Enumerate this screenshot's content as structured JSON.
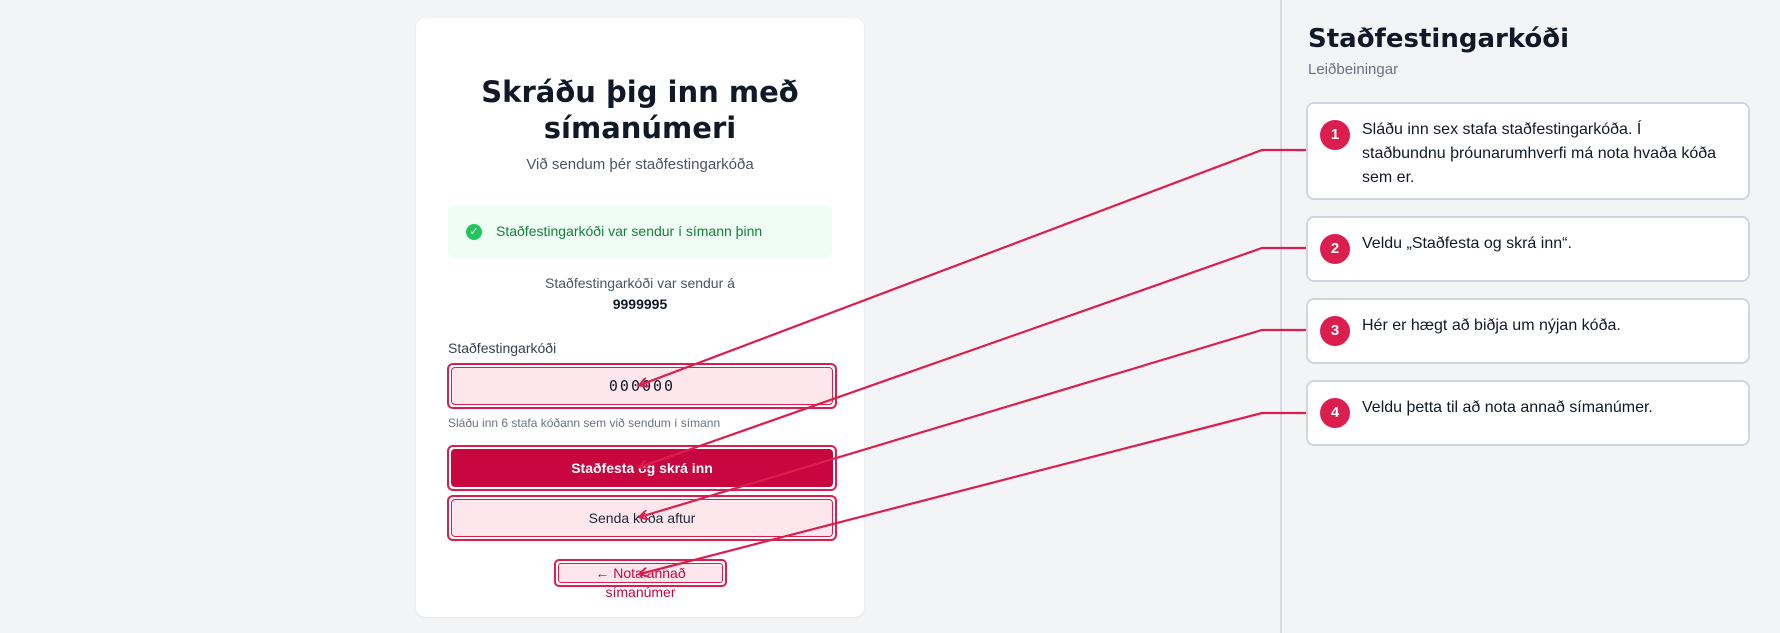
{
  "login": {
    "title": "Skráðu þig inn með símanúmeri",
    "subtitle": "Við sendum þér staðfestingarkóða",
    "alert": {
      "icon": "check-circle-icon",
      "text": "Staðfestingarkóði var sendur í símann þinn"
    },
    "sent_to_label": "Staðfestingarkóði var sendur á",
    "sent_to_phone": "9999995",
    "code_field": {
      "label": "Staðfestingarkóði",
      "value": "000000",
      "hint": "Sláðu inn 6 stafa kóðann sem við sendum í símann"
    },
    "confirm_button": "Staðfesta og skrá inn",
    "resend_button": "Senda kóða aftur",
    "change_phone_link": "← Nota annað símanúmer"
  },
  "panel": {
    "title": "Staðfestingarkóði",
    "subtitle": "Leiðbeiningar",
    "steps": [
      {
        "number": "1",
        "text": "Sláðu inn sex stafa staðfestingarkóða. Í staðbundnu þróunarumhverfi má nota hvaða kóða sem er."
      },
      {
        "number": "2",
        "text": "Veldu „Staðfesta og skrá inn“."
      },
      {
        "number": "3",
        "text": "Hér er hægt að biðja um nýjan kóða."
      },
      {
        "number": "4",
        "text": "Veldu þetta til að nota annað símanúmer."
      }
    ]
  },
  "colors": {
    "accent": "#dc1e4f",
    "primary_button": "#c8063f",
    "success": "#22c55e",
    "success_text": "#15803d"
  }
}
